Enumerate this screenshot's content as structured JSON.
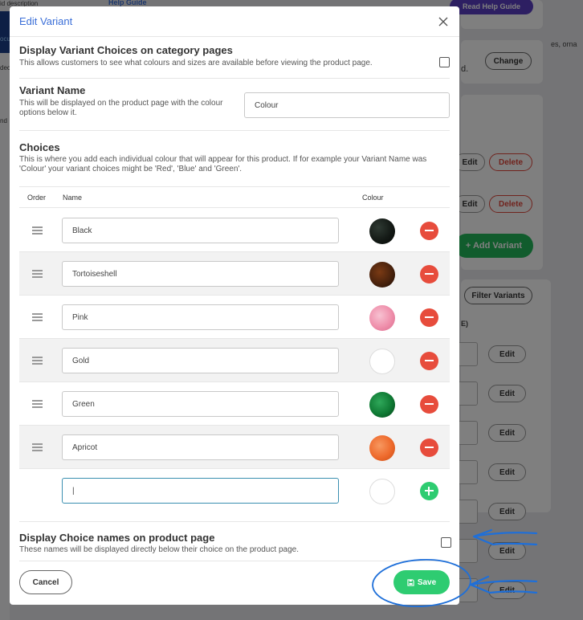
{
  "background": {
    "left_texts": [
      "id description",
      "dec",
      "ocu",
      "nd"
    ],
    "help_guide": "Help Guide",
    "read_help_guide": "Read Help Guide",
    "right_snippets": [
      "es, orna",
      "d."
    ],
    "change_label": "Change",
    "edit_label": "Edit",
    "delete_label": "Delete",
    "add_variant_label": "+ Add Variant",
    "filter_variants_label": "Filter Variants",
    "column_e": "E)"
  },
  "modal": {
    "title": "Edit Variant",
    "display_choices": {
      "title": "Display Variant Choices on category pages",
      "description": "This allows customers to see what colours and sizes are available before viewing the product page.",
      "checked": false
    },
    "variant_name": {
      "title": "Variant Name",
      "description": "This will be displayed on the product page with the colour options below it.",
      "value": "Colour"
    },
    "choices": {
      "title": "Choices",
      "description": "This is where you add each individual colour that will appear for this product. If for example your Variant Name was 'Colour' your variant choices might be 'Red', 'Blue' and 'Green'.",
      "columns": {
        "order": "Order",
        "name": "Name",
        "colour": "Colour"
      },
      "items": [
        {
          "name": "Black",
          "swatch": "black-beads"
        },
        {
          "name": "Tortoiseshell",
          "swatch": "tortoiseshell-beads"
        },
        {
          "name": "Pink",
          "swatch": "pink-beads"
        },
        {
          "name": "Gold",
          "swatch": "empty"
        },
        {
          "name": "Green",
          "swatch": "green-beads"
        },
        {
          "name": "Apricot",
          "swatch": "apricot-beads"
        }
      ],
      "new_item_value": "|"
    },
    "display_names": {
      "title": "Display Choice names on product page",
      "description": "These names will be displayed directly below their choice on the product page.",
      "checked": false
    },
    "cancel_label": "Cancel",
    "save_label": "Save"
  },
  "colors": {
    "title_blue": "#3b6fd8",
    "save_green": "#2ecc71",
    "remove_red": "#e74c3c",
    "annotation_blue": "#1e6fd9",
    "swatch_black": "#141a16",
    "swatch_tortoiseshell": "#4a230d",
    "swatch_pink": "#ef8fab",
    "swatch_green": "#0f7a34",
    "swatch_apricot": "#ee6a2c"
  }
}
